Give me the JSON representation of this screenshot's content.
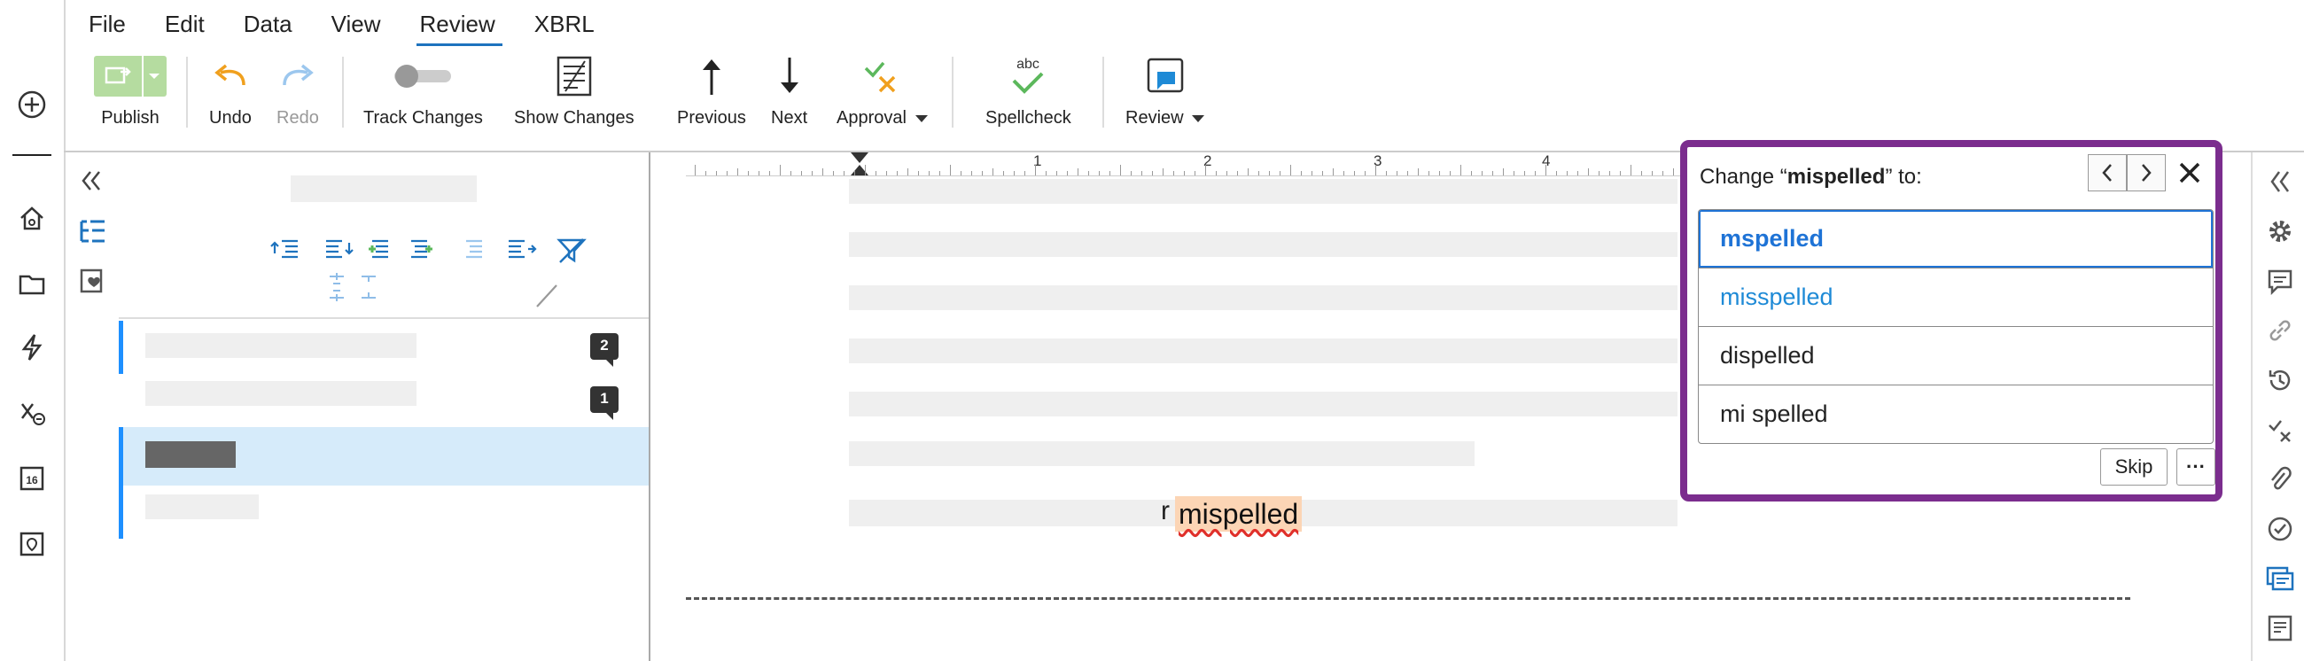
{
  "menu": {
    "items": [
      "File",
      "Edit",
      "Data",
      "View",
      "Review",
      "XBRL"
    ],
    "active": "Review"
  },
  "toolbar": {
    "publish": "Publish",
    "undo": "Undo",
    "redo": "Redo",
    "track_changes": "Track Changes",
    "show_changes": "Show Changes",
    "previous": "Previous",
    "next": "Next",
    "approval": "Approval",
    "spellcheck": "Spellcheck",
    "spellcheck_icon_text": "abc",
    "review": "Review"
  },
  "outline": {
    "badges": [
      "2",
      "1"
    ]
  },
  "ruler": {
    "numbers": [
      "1",
      "2",
      "3",
      "4"
    ]
  },
  "document": {
    "misspelled_word": "mispelled",
    "prefix_char": "r"
  },
  "spell_popup": {
    "title_prefix": "Change “",
    "word": "mispelled",
    "title_suffix": "” to:",
    "suggestions": [
      "mspelled",
      "misspelled",
      "dispelled",
      "mi spelled"
    ],
    "skip": "Skip",
    "more": "···"
  },
  "colors": {
    "accent": "#1e73be",
    "popup_border": "#7b2d8e",
    "highlight": "#fcd5b5",
    "selected_row": "#d6ebfa"
  }
}
